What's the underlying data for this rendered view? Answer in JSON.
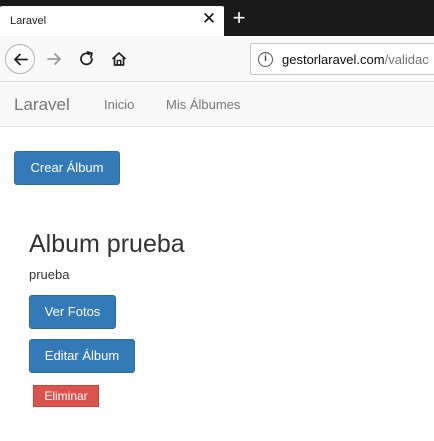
{
  "browser": {
    "tab_title": "Laravel",
    "tab_close": "✕",
    "new_tab": "+",
    "url_host": "gestorlaravel.com",
    "url_path": "/validac",
    "info_icon": "i"
  },
  "navbar": {
    "brand": "Laravel",
    "links": [
      "Inicio",
      "Mis Álbumes"
    ]
  },
  "actions": {
    "create_album": "Crear Álbum"
  },
  "album": {
    "title": "Album prueba",
    "description": "prueba",
    "view_photos": "Ver Fotos",
    "edit_album": "Editar Álbum",
    "delete": "Eliminar"
  },
  "colors": {
    "primary": "#337ab7",
    "danger": "#d9534f",
    "tabbar": "#1a1a1a"
  }
}
